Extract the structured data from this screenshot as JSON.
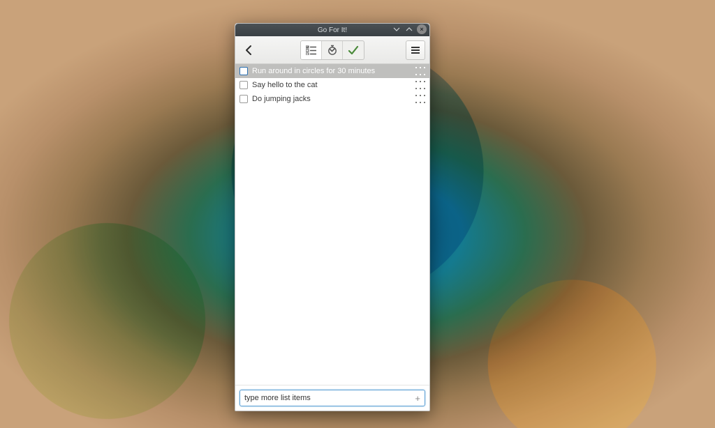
{
  "window": {
    "title": "Go For It!"
  },
  "toolbar": {
    "back_icon": "chevron-left",
    "tabs": [
      {
        "id": "list",
        "icon": "list-check",
        "active": true
      },
      {
        "id": "timer",
        "icon": "timer",
        "active": false
      },
      {
        "id": "done",
        "icon": "check",
        "active": false
      }
    ],
    "menu_icon": "hamburger"
  },
  "tasks": [
    {
      "label": "Run around in circles for 30 minutes",
      "checked": false,
      "selected": true
    },
    {
      "label": "Say hello to the cat",
      "checked": false,
      "selected": false
    },
    {
      "label": "Do jumping jacks",
      "checked": false,
      "selected": false
    }
  ],
  "footer": {
    "input_value": "type more list items",
    "plus_label": "+"
  },
  "colors": {
    "accent": "#5a9fd4",
    "selected_row": "#bfbfbd",
    "titlebar": "#3e4448"
  }
}
